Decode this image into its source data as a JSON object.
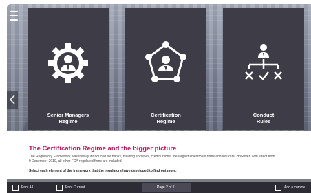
{
  "tiles": [
    {
      "label_line1": "Senior Managers",
      "label_line2": "Regime",
      "icon": "gear-person-icon"
    },
    {
      "label_line1": "Certification",
      "label_line2": "Regime",
      "icon": "network-person-icon"
    },
    {
      "label_line1": "Conduct",
      "label_line2": "Rules",
      "icon": "org-chart-rules-icon"
    }
  ],
  "content": {
    "title": "The Certification Regime and the bigger picture",
    "body_line1": "The Regulatory Framework was initially introduced for banks, building societies, credit unions, the largest investment firms and insurers. However, with effect from",
    "body_line2": "9 December 2019, all other FCA regulated firms are included.",
    "cta": "Select each element of the framework that the regulators have developed to find out more."
  },
  "footer": {
    "print_all": "Print All",
    "print_current": "Print Current",
    "page_indicator": "Page 2 of 11",
    "add_comment": "Add a comme"
  },
  "colors": {
    "tile_bg": "#3e3d47",
    "title_accent": "#c0155a",
    "footer_bg": "#2d2c35"
  }
}
